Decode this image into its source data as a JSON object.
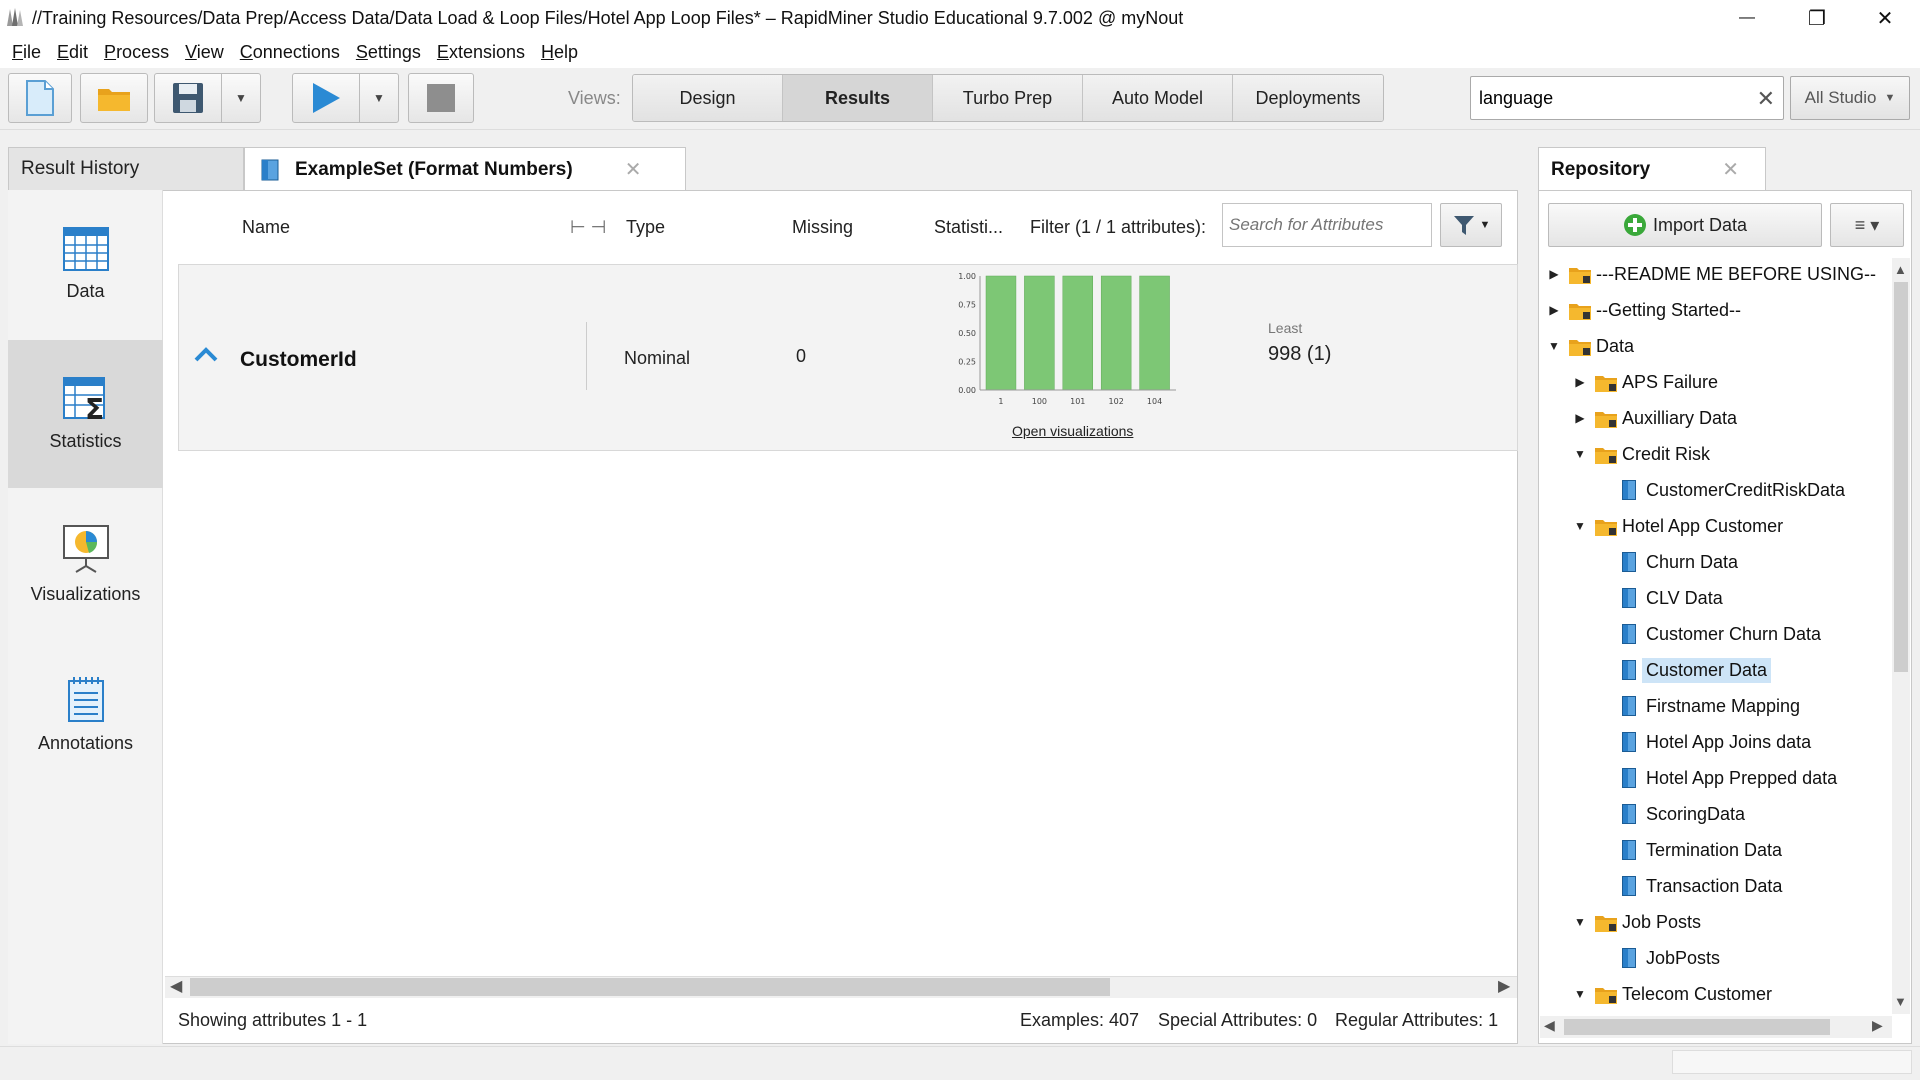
{
  "window": {
    "title": "//Training Resources/Data Prep/Access Data/Data Load & Loop Files/Hotel App Loop Files* – RapidMiner Studio Educational 9.7.002 @ myNout",
    "minimize": "—",
    "restore": "❐",
    "close": "✕"
  },
  "menu": [
    {
      "key": "F",
      "rest": "ile"
    },
    {
      "key": "E",
      "rest": "dit"
    },
    {
      "key": "P",
      "rest": "rocess"
    },
    {
      "key": "V",
      "rest": "iew"
    },
    {
      "key": "C",
      "rest": "onnections"
    },
    {
      "key": "S",
      "rest": "ettings"
    },
    {
      "key": "E",
      "rest": "xtensions"
    },
    {
      "key": "H",
      "rest": "elp"
    }
  ],
  "toolbar": {
    "views_label": "Views:",
    "views": [
      "Design",
      "Results",
      "Turbo Prep",
      "Auto Model",
      "Deployments"
    ],
    "active_view": "Results",
    "search_value": "language",
    "search_clear": "✕",
    "scope": "All Studio"
  },
  "tabs": {
    "result_history": "Result History",
    "exampleset": "ExampleSet (Format Numbers)",
    "close": "✕"
  },
  "sidenav": [
    "Data",
    "Statistics",
    "Visualizations",
    "Annotations"
  ],
  "active_nav": "Statistics",
  "columns": {
    "name": "Name",
    "type": "Type",
    "missing": "Missing",
    "statistics": "Statisti...",
    "filter": "Filter (1 / 1 attributes):",
    "search_placeholder": "Search for Attributes"
  },
  "attribute": {
    "name": "CustomerId",
    "type": "Nominal",
    "missing": "0",
    "least_label": "Least",
    "least_value": "998 (1)",
    "open_viz": "Open visualizations"
  },
  "chart_data": {
    "type": "bar",
    "categories": [
      "1",
      "100",
      "101",
      "102",
      "104"
    ],
    "values": [
      1,
      1,
      1,
      1,
      1
    ],
    "ylim": [
      0,
      1
    ],
    "yticks": [
      "0.00",
      "0.25",
      "0.50",
      "0.75",
      "1.00"
    ],
    "bar_color": "#7dc775"
  },
  "status": {
    "showing": "Showing attributes 1 - 1",
    "examples": "Examples: 407",
    "special": "Special Attributes: 0",
    "regular": "Regular Attributes: 1"
  },
  "repository": {
    "title": "Repository",
    "close": "✕",
    "import_label": "Import Data",
    "menu_label": "≡ ▾",
    "tree": [
      {
        "label": "---README ME BEFORE USING--",
        "level": 0,
        "kind": "folder",
        "state": "collapsed"
      },
      {
        "label": "--Getting Started--",
        "level": 0,
        "kind": "folder",
        "state": "collapsed"
      },
      {
        "label": "Data",
        "level": 0,
        "kind": "folder",
        "state": "expanded"
      },
      {
        "label": "APS Failure",
        "level": 1,
        "kind": "folder",
        "state": "collapsed"
      },
      {
        "label": "Auxilliary Data",
        "level": 1,
        "kind": "folder",
        "state": "collapsed"
      },
      {
        "label": "Credit Risk",
        "level": 1,
        "kind": "folder",
        "state": "expanded"
      },
      {
        "label": "CustomerCreditRiskData",
        "level": 2,
        "kind": "data"
      },
      {
        "label": "Hotel App Customer",
        "level": 1,
        "kind": "folder",
        "state": "expanded"
      },
      {
        "label": "Churn Data",
        "level": 2,
        "kind": "data"
      },
      {
        "label": "CLV Data",
        "level": 2,
        "kind": "data"
      },
      {
        "label": "Customer Churn Data",
        "level": 2,
        "kind": "data"
      },
      {
        "label": "Customer Data",
        "level": 2,
        "kind": "data",
        "selected": true
      },
      {
        "label": "Firstname Mapping",
        "level": 2,
        "kind": "data"
      },
      {
        "label": "Hotel App Joins data",
        "level": 2,
        "kind": "data"
      },
      {
        "label": "Hotel App Prepped data",
        "level": 2,
        "kind": "data"
      },
      {
        "label": "ScoringData",
        "level": 2,
        "kind": "data"
      },
      {
        "label": "Termination Data",
        "level": 2,
        "kind": "data"
      },
      {
        "label": "Transaction Data",
        "level": 2,
        "kind": "data"
      },
      {
        "label": "Job Posts",
        "level": 1,
        "kind": "folder",
        "state": "expanded"
      },
      {
        "label": "JobPosts",
        "level": 2,
        "kind": "data"
      },
      {
        "label": "Telecom Customer",
        "level": 1,
        "kind": "folder",
        "state": "expanded"
      }
    ]
  },
  "colors": {
    "accent_blue": "#2a8ad4",
    "folder": "#f5b82e",
    "selected": "#cde4f7",
    "play": "#2a8ad4",
    "import_plus": "#3aa83a"
  }
}
